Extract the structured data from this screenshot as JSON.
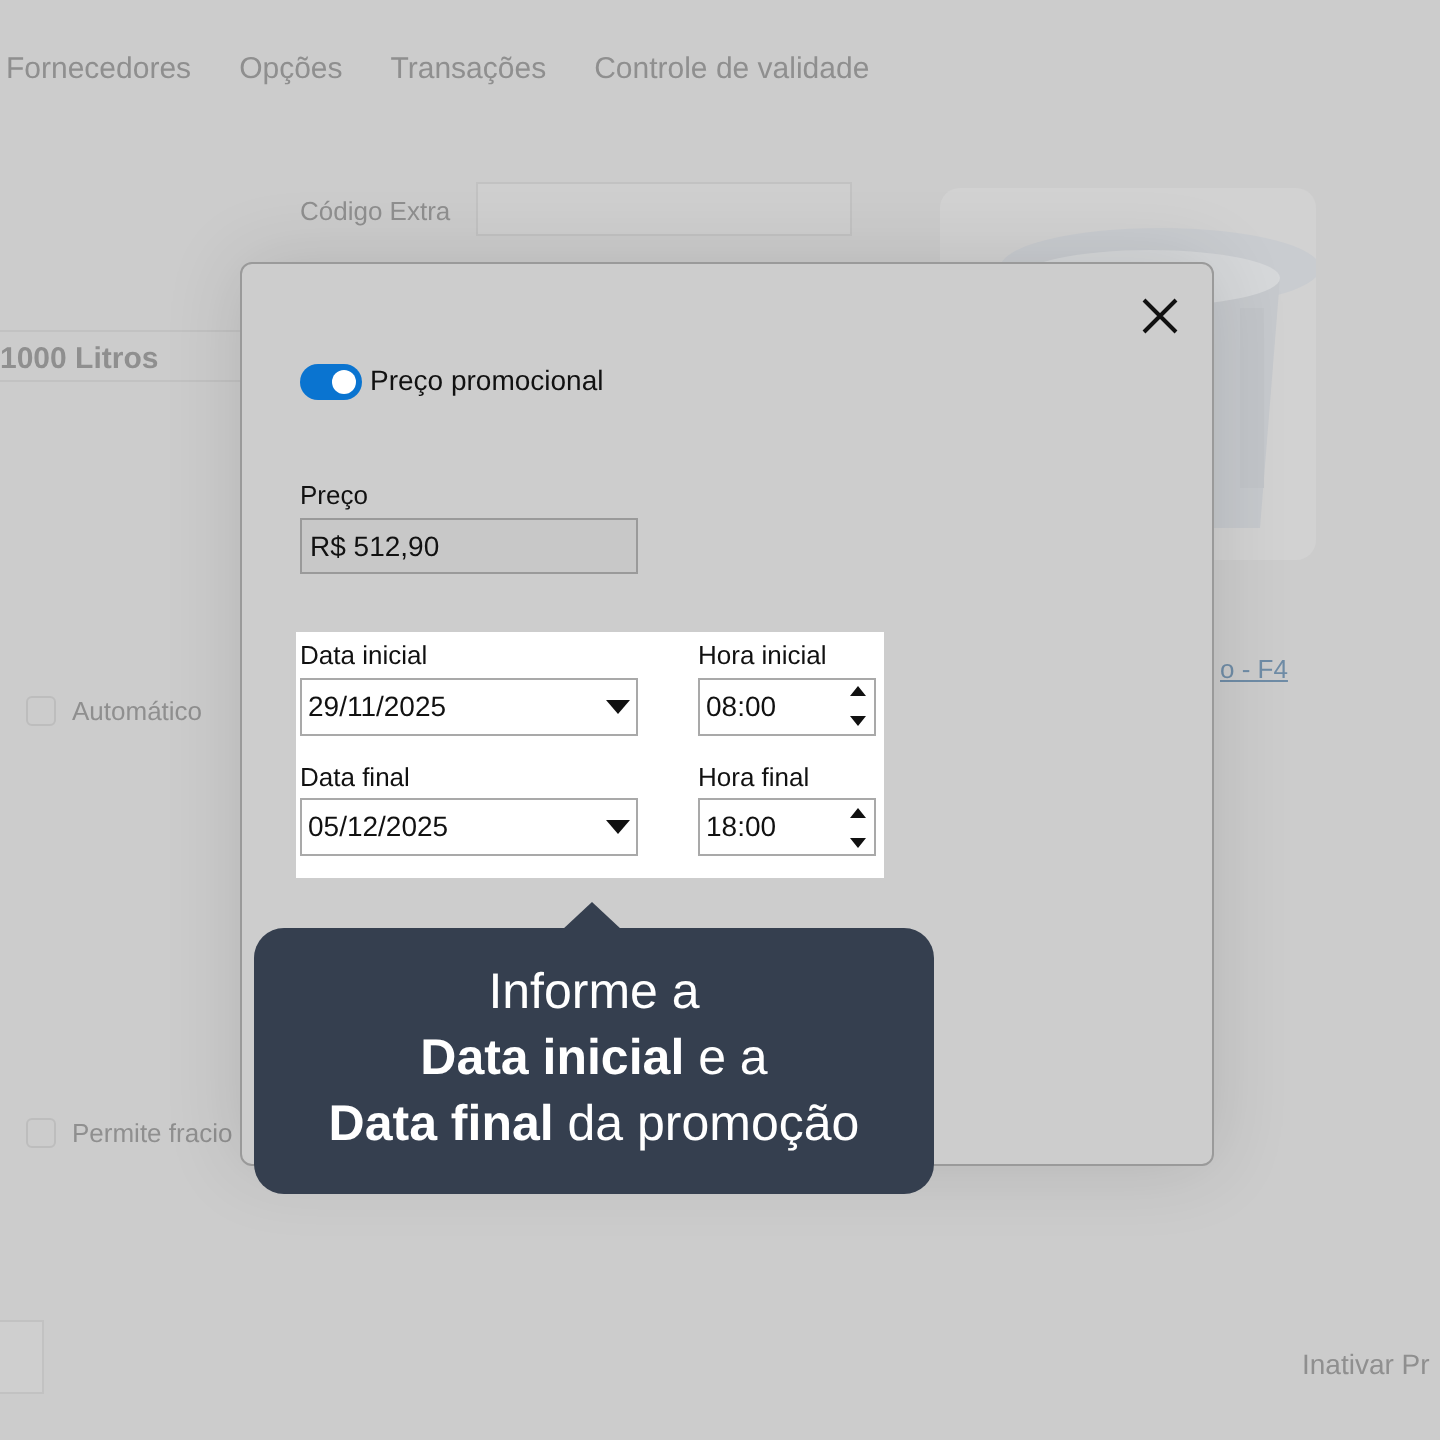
{
  "tabs": [
    {
      "label": "Fornecedores",
      "selected": false
    },
    {
      "label": "Opções",
      "selected": false
    },
    {
      "label": "Transações",
      "selected": false
    },
    {
      "label": "Controle de validade",
      "selected": false
    }
  ],
  "background_form": {
    "extra_code_label": "Código Extra",
    "product_name": "1000 Litros",
    "automatic_checkbox": {
      "label": "Automático",
      "checked": false
    },
    "link": "o - F4",
    "fractional_checkbox": {
      "label": "Permite fracio",
      "checked": false
    },
    "deactivate_button": "Inativar Pr"
  },
  "dialog": {
    "promo_toggle": {
      "label": "Preço promocional",
      "on": true
    },
    "price": {
      "label": "Preço",
      "value": "R$ 512,90"
    },
    "fields": [
      {
        "kind": "date",
        "label": "Data inicial",
        "value": "29/11/2025"
      },
      {
        "kind": "time",
        "label": "Hora inicial",
        "value": "08:00"
      },
      {
        "kind": "date",
        "label": "Data final",
        "value": "05/12/2025"
      },
      {
        "kind": "time",
        "label": "Hora final",
        "value": "18:00"
      }
    ]
  },
  "tooltip": {
    "lines": [
      "Informe a",
      "**Data inicial** e a",
      "**Data final** da promoção"
    ]
  }
}
